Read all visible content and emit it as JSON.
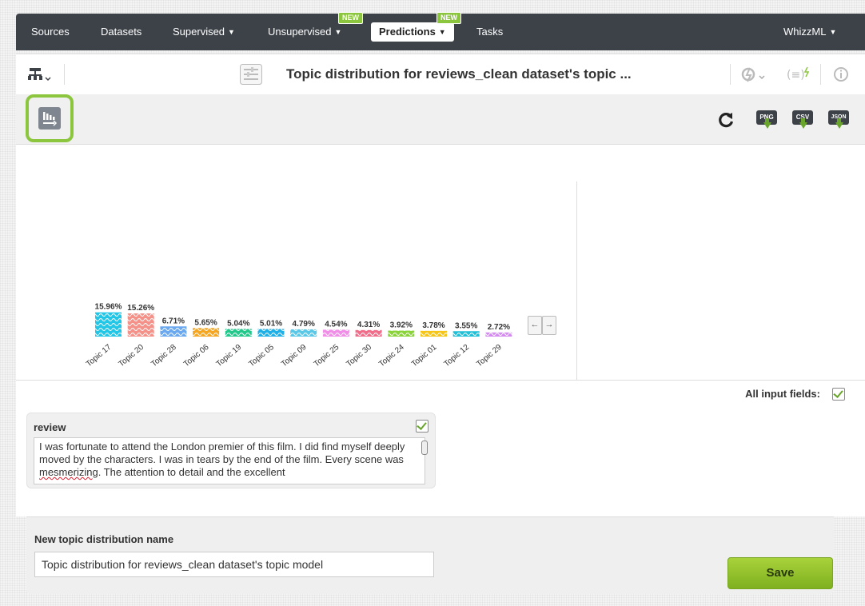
{
  "nav": {
    "items": [
      {
        "label": "Sources",
        "caret": false
      },
      {
        "label": "Datasets",
        "caret": false
      },
      {
        "label": "Supervised",
        "caret": true
      },
      {
        "label": "Unsupervised",
        "caret": true
      }
    ],
    "active": "Predictions",
    "tasks": "Tasks",
    "whizzml": "WhizzML",
    "new_badge": "NEW"
  },
  "title": "Topic distribution for reviews_clean dataset's topic ...",
  "toolbar": {
    "png": "PNG",
    "csv": "CSV",
    "json": "JSON"
  },
  "chart_data": {
    "type": "bar",
    "categories": [
      "Topic 17",
      "Topic 20",
      "Topic 28",
      "Topic 06",
      "Topic 19",
      "Topic 05",
      "Topic 09",
      "Topic 25",
      "Topic 30",
      "Topic 24",
      "Topic 01",
      "Topic 12",
      "Topic 29"
    ],
    "values": [
      15.96,
      15.26,
      6.71,
      5.65,
      5.04,
      5.01,
      4.79,
      4.54,
      4.31,
      3.92,
      3.78,
      3.55,
      2.72
    ],
    "data_labels": [
      "15.96%",
      "15.26%",
      "6.71%",
      "5.65%",
      "5.04%",
      "5.01%",
      "4.79%",
      "4.54%",
      "4.31%",
      "3.92%",
      "3.78%",
      "3.55%",
      "2.72%"
    ],
    "colors": [
      "#22c7e8",
      "#f4928a",
      "#6aa8f0",
      "#f5a623",
      "#23c98a",
      "#1fb0e8",
      "#5bc8e8",
      "#f08ee8",
      "#f06e8a",
      "#8ad43a",
      "#f5c518",
      "#1fc0d8",
      "#d48af0"
    ],
    "unit": "%"
  },
  "scroll": {
    "left": "←",
    "right": "→"
  },
  "inputs": {
    "all_fields_label": "All input fields:",
    "review_label": "review",
    "review_text_before": "I was fortunate to attend the London premier of this film. I did find myself deeply moved by the characters. I was in tears by the end of the film. Every scene was ",
    "review_text_misspelled": "mesmerizing",
    "review_text_after": ". The attention to detail and the excellent"
  },
  "name": {
    "label": "New topic distribution name",
    "value": "Topic distribution for reviews_clean dataset's topic model"
  },
  "save_label": "Save"
}
